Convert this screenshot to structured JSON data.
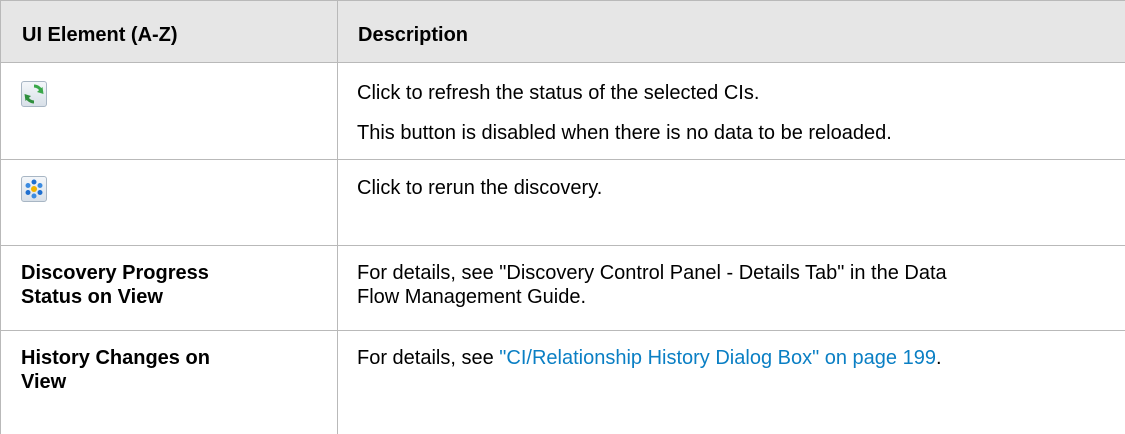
{
  "table": {
    "headers": {
      "col1": "UI Element (A-Z)",
      "col2": "Description"
    },
    "rows": [
      {
        "icon": "refresh-icon",
        "desc1": "Click to refresh the status of the selected CIs.",
        "desc2": "This button is disabled when there is no data to be reloaded."
      },
      {
        "icon": "rerun-discovery-icon",
        "desc1": "Click to rerun the discovery."
      },
      {
        "element_line1": "Discovery Progress",
        "element_line2": "Status on View",
        "desc1": "For details, see \"Discovery Control Panel - Details Tab\" in the Data",
        "desc2": "Flow Management Guide."
      },
      {
        "element_line1": "History Changes on",
        "element_line2": "View",
        "desc_prefix": "For details, see ",
        "desc_link": "\"CI/Relationship History Dialog Box\" on page 199",
        "desc_suffix": "."
      }
    ]
  },
  "colors": {
    "header_bg": "#e6e6e6",
    "border": "#b9b9b9",
    "link": "#0a7fc4"
  }
}
